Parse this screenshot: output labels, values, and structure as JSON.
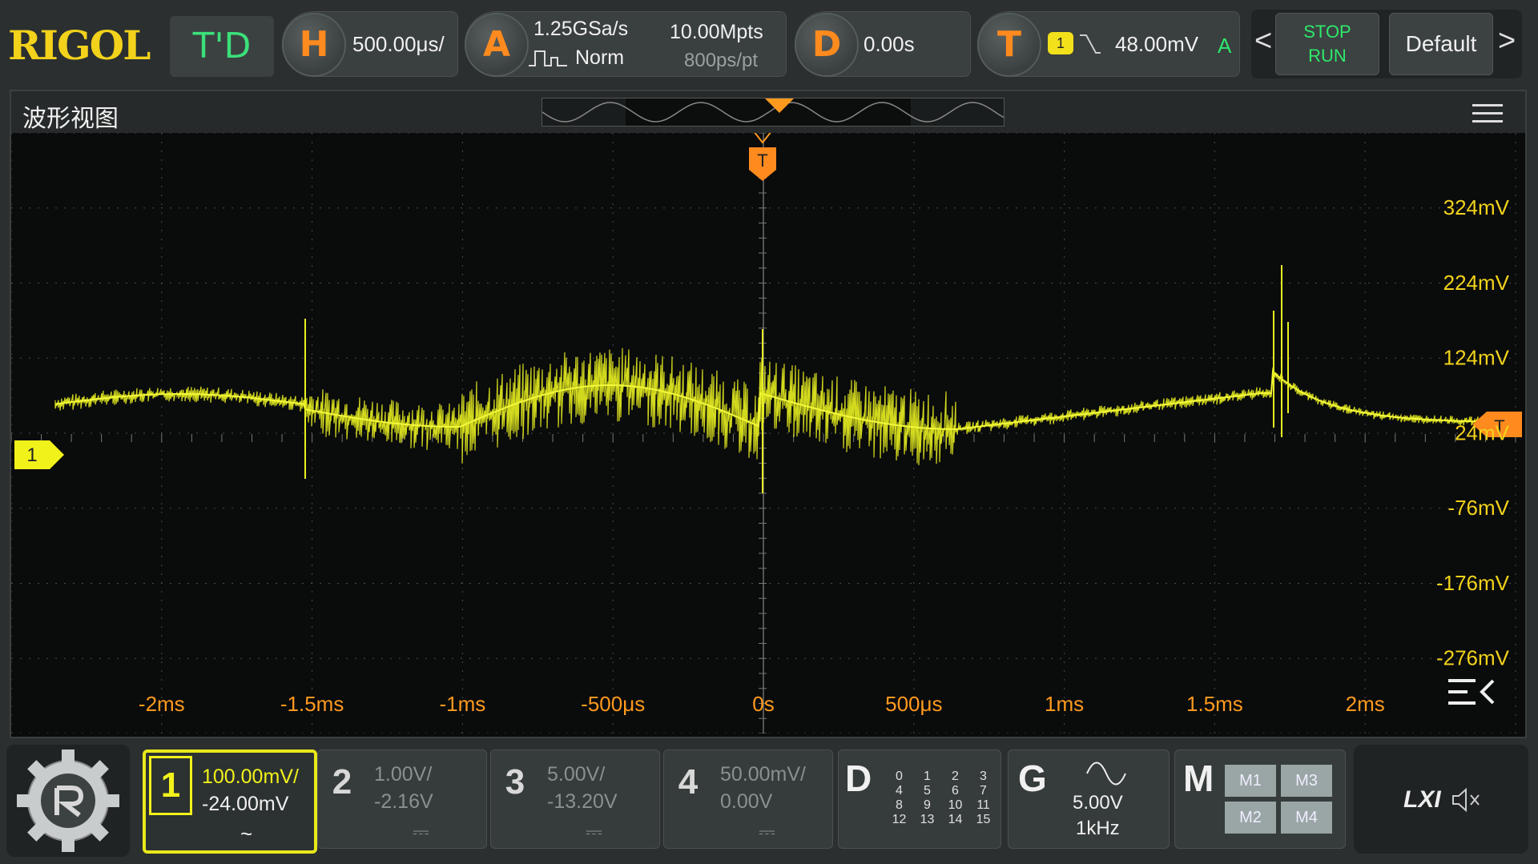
{
  "top": {
    "logo": "RIGOL",
    "mode": "T'D",
    "horizontal": {
      "letter": "H",
      "scale": "500.00μs/"
    },
    "acquire": {
      "letter": "A",
      "sample_rate": "1.25GSa/s",
      "memory": "10.00Mpts",
      "mode": "Norm",
      "resolution": "800ps/pt"
    },
    "delay": {
      "letter": "D",
      "value": "0.00s"
    },
    "trigger": {
      "letter": "T",
      "source": "1",
      "level": "48.00mV",
      "sweep": "A"
    },
    "stop_label": "STOP",
    "run_label": "RUN",
    "default_label": "Default",
    "prev_arrow": "<",
    "next_arrow": ">"
  },
  "waveform": {
    "title": "波形视图",
    "channel_marker": "1",
    "trigger_marker": "T",
    "v_labels": [
      "324mV",
      "224mV",
      "124mV",
      "24mV",
      "-76mV",
      "-176mV",
      "-276mV"
    ],
    "t_labels": [
      "-2ms",
      "-1.5ms",
      "-1ms",
      "-500μs",
      "0s",
      "500μs",
      "1ms",
      "1.5ms",
      "2ms"
    ],
    "trace_color": "#e8f020",
    "label_color": "#f2d21b",
    "time_label_color": "#ff9a1e"
  },
  "channels": [
    {
      "num": "1",
      "scale": "100.00mV/",
      "offset": "-24.00mV",
      "coupling": "~"
    },
    {
      "num": "2",
      "scale": "1.00V/",
      "offset": "-2.16V",
      "coupling": "⎓"
    },
    {
      "num": "3",
      "scale": "5.00V/",
      "offset": "-13.20V",
      "coupling": "⎓"
    },
    {
      "num": "4",
      "scale": "50.00mV/",
      "offset": "0.00V",
      "coupling": "⎓"
    }
  ],
  "digital": {
    "letter": "D",
    "bits": [
      "0",
      "1",
      "2",
      "3",
      "4",
      "5",
      "6",
      "7",
      "8",
      "9",
      "10",
      "11",
      "12",
      "13",
      "14",
      "15"
    ]
  },
  "generator": {
    "letter": "G",
    "amplitude": "5.00V",
    "frequency": "1kHz"
  },
  "math": {
    "letter": "M",
    "items": [
      "M1",
      "M3",
      "M2",
      "M4"
    ]
  },
  "lxi": {
    "label": "LXI"
  }
}
